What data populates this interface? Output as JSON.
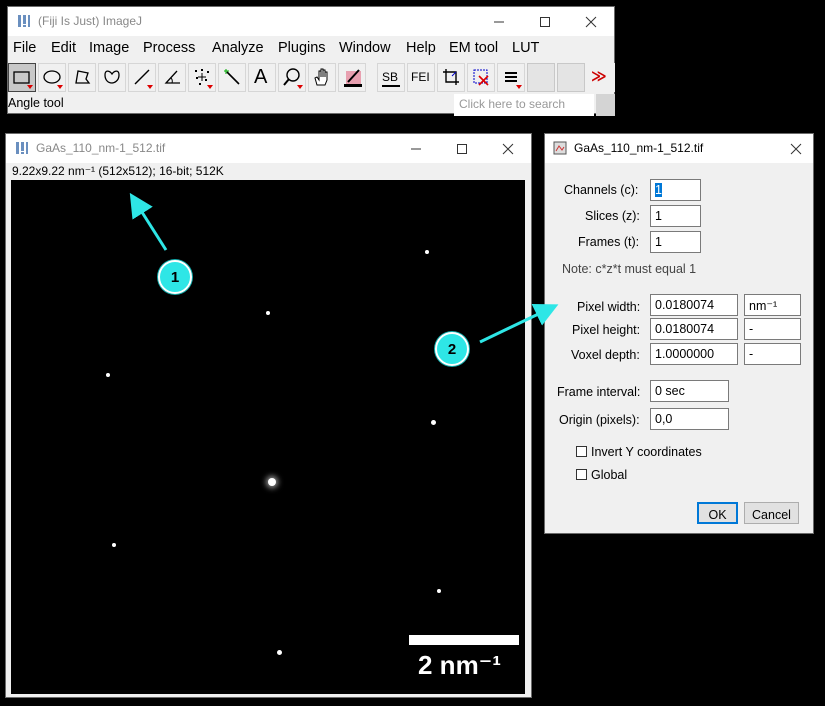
{
  "main_window": {
    "title": "(Fiji Is Just) ImageJ",
    "menus": [
      "File",
      "Edit",
      "Image",
      "Process",
      "Analyze",
      "Plugins",
      "Window",
      "Help",
      "EM tool",
      "LUT"
    ],
    "tools": {
      "text_sb": "SB",
      "text_fei": "FEI",
      "text_a": "A",
      "more": "≫"
    },
    "status": "Angle tool",
    "search_placeholder": "Click here to search"
  },
  "image_window": {
    "title": "GaAs_110_nm-1_512.tif",
    "info": "9.22x9.22 nm⁻¹ (512x512); 16-bit; 512K",
    "scale_bar_label": "2 nm⁻¹"
  },
  "dialog": {
    "title": "GaAs_110_nm-1_512.tif",
    "channels_label": "Channels (c):",
    "channels_value": "1",
    "slices_label": "Slices (z):",
    "slices_value": "1",
    "frames_label": "Frames (t):",
    "frames_value": "1",
    "note": "Note: c*z*t must equal 1",
    "pixel_width_label": "Pixel width:",
    "pixel_width_value": "0.0180074",
    "pixel_width_unit": "nm⁻¹",
    "pixel_height_label": "Pixel height:",
    "pixel_height_value": "0.0180074",
    "pixel_height_unit": "-",
    "voxel_depth_label": "Voxel depth:",
    "voxel_depth_value": "1.0000000",
    "voxel_depth_unit": "-",
    "frame_interval_label": "Frame interval:",
    "frame_interval_value": "0 sec",
    "origin_label": "Origin (pixels):",
    "origin_value": "0,0",
    "invert_y_label": "Invert Y coordinates",
    "global_label": "Global",
    "ok_label": "OK",
    "cancel_label": "Cancel"
  },
  "annotations": {
    "callout_1": "1",
    "callout_2": "2",
    "color": "#2ee6e6"
  }
}
